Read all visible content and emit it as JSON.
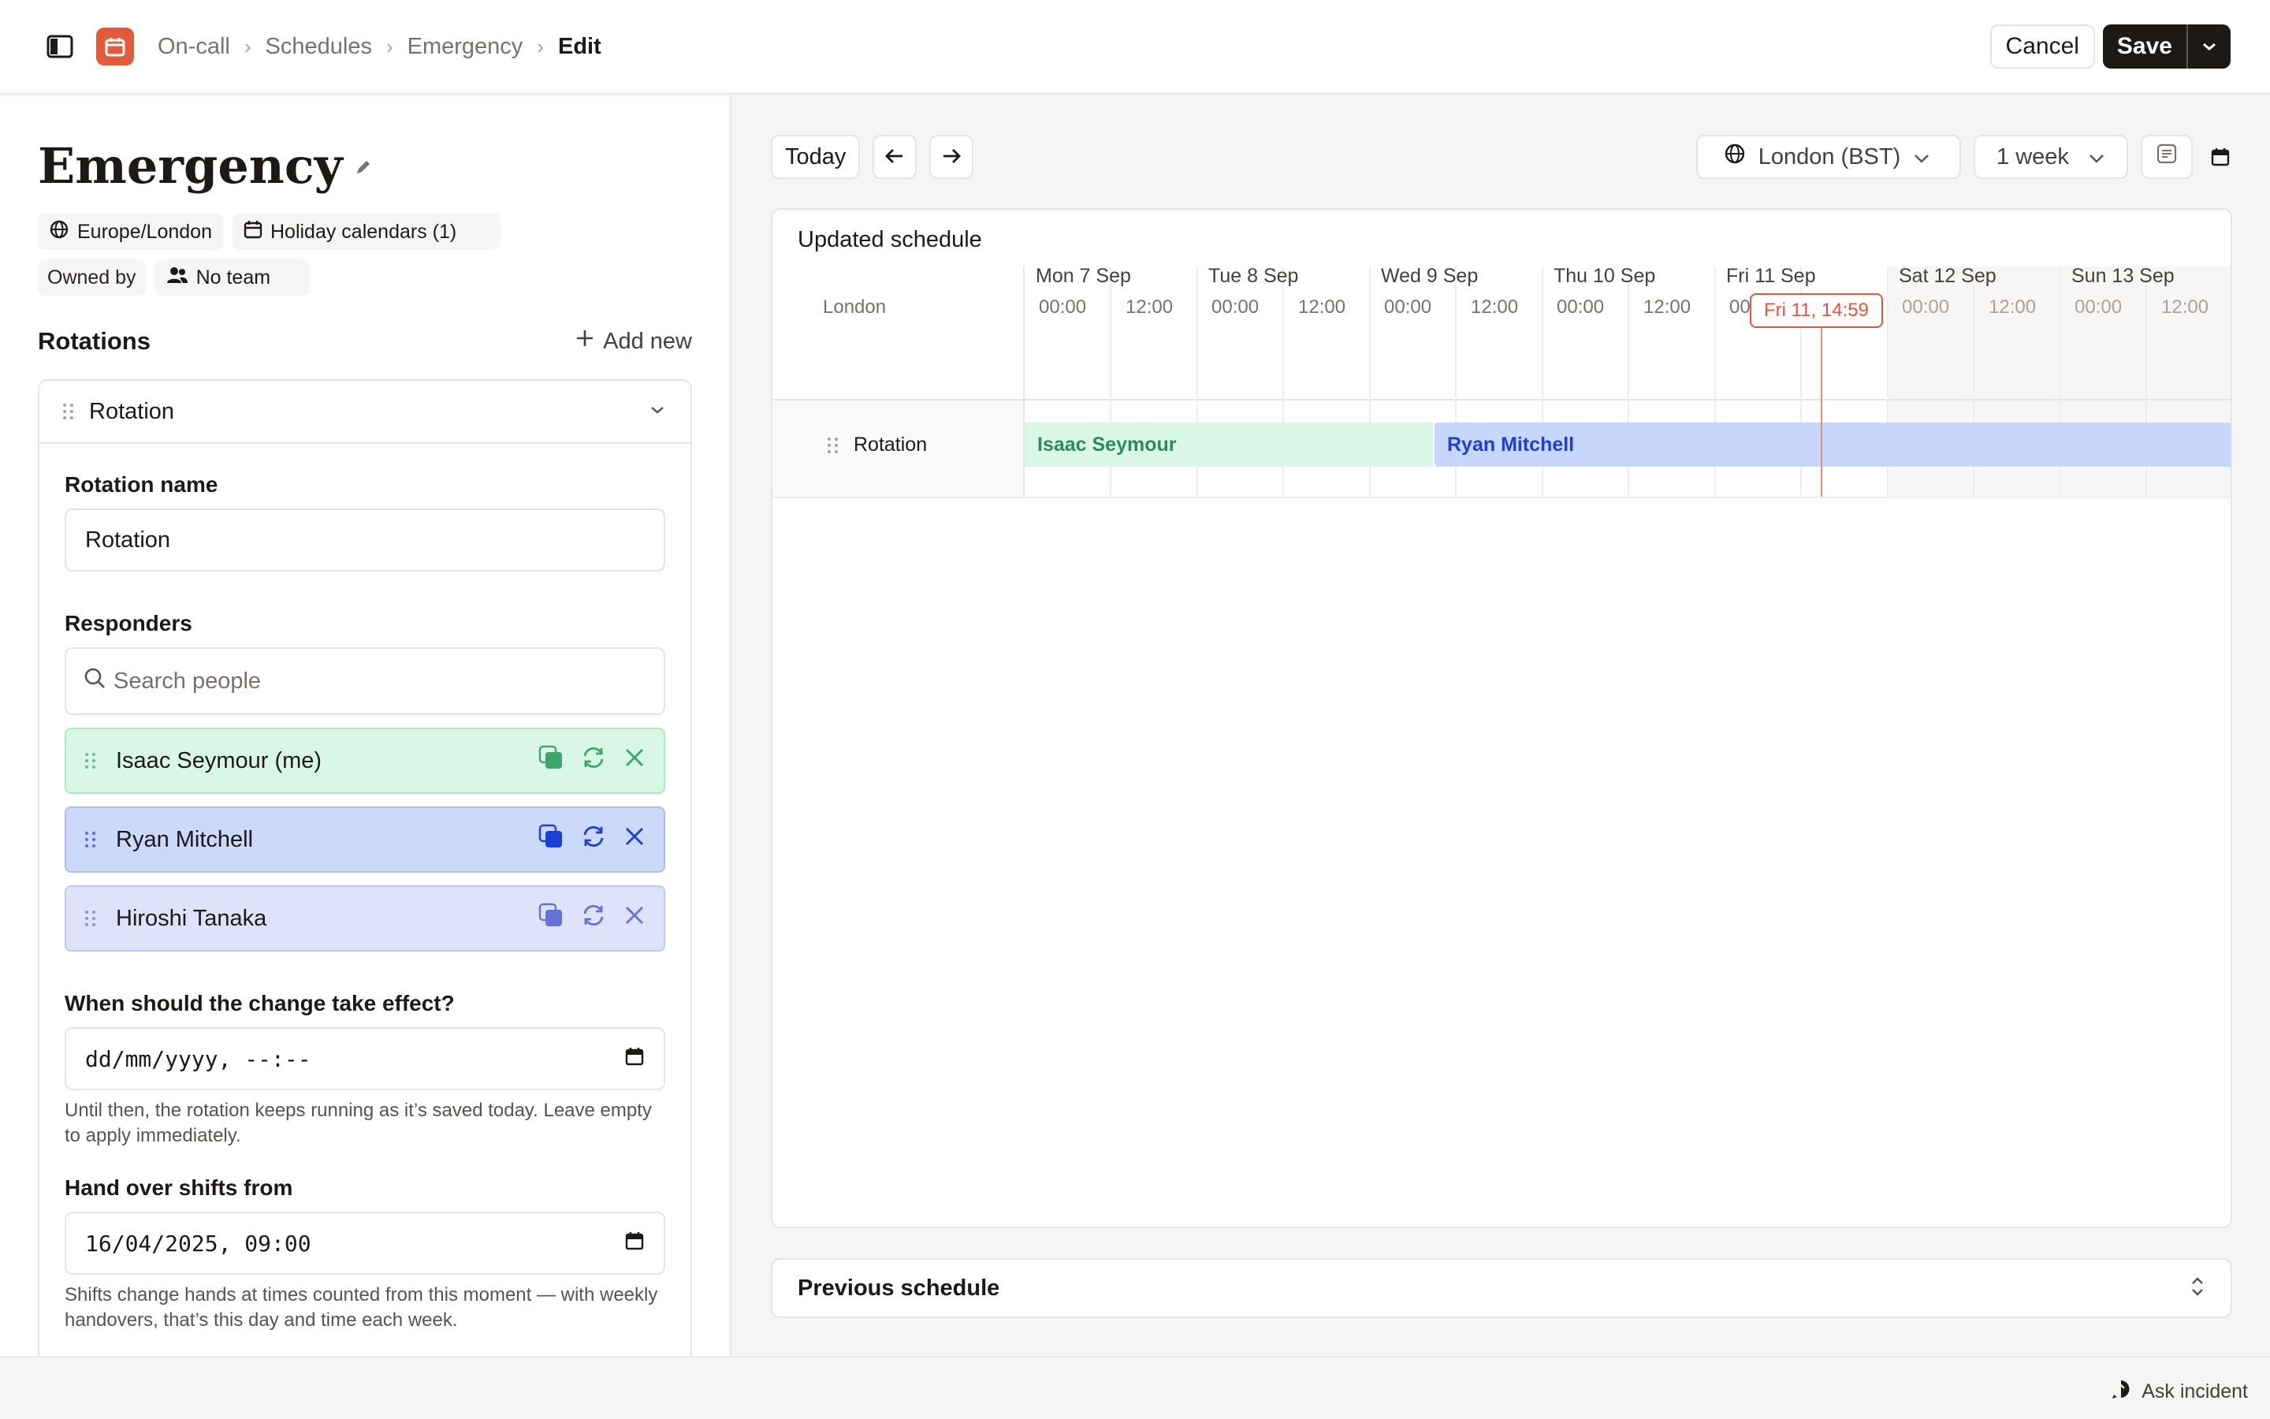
{
  "breadcrumb": [
    "On-call",
    "Schedules",
    "Emergency",
    "Edit"
  ],
  "header": {
    "cancel_label": "Cancel",
    "save_label": "Save"
  },
  "page": {
    "title": "Emergency",
    "timezone_chip": "Europe/London",
    "holiday_chip": "Holiday calendars (1)",
    "owned_by_label": "Owned by",
    "team_chip": "No team"
  },
  "rotations": {
    "title": "Rotations",
    "add_new_label": "Add new",
    "card_title": "Rotation",
    "name_label": "Rotation name",
    "name_value": "Rotation",
    "responders_label": "Responders",
    "search_placeholder": "Search people",
    "responders": [
      {
        "name": "Isaac Seymour (me)",
        "color": "#3aa86b"
      },
      {
        "name": "Ryan Mitchell",
        "color": "#1d3fd8"
      },
      {
        "name": "Hiroshi Tanaka",
        "color": "#6670d9"
      }
    ],
    "effect_label": "When should the change take effect?",
    "effect_value": "dd/mm/yyyy, --:--",
    "effect_help": "Until then, the rotation keeps running as it’s saved today. Leave empty to apply immediately.",
    "handover_label": "Hand over shifts from",
    "handover_value": "16/04/2025, 09:00",
    "handover_help": "Shifts change hands at times counted from this moment — with weekly handovers, that’s this day and time each week."
  },
  "calendar": {
    "today_label": "Today",
    "timezone_label": "London (BST)",
    "range_label": "1 week",
    "schedule_title": "Updated schedule",
    "location_label": "London",
    "days": [
      "Mon 7 Sep",
      "Tue 8 Sep",
      "Wed 9 Sep",
      "Thu 10 Sep",
      "Fri 11 Sep",
      "Sat 12 Sep",
      "Sun 13 Sep"
    ],
    "times": [
      "00:00",
      "12:00"
    ],
    "now_label": "Fri 11, 14:59",
    "row_label": "Rotation",
    "shifts": [
      {
        "name": "Isaac Seymour",
        "color": "#d9f7e6"
      },
      {
        "name": "Ryan Mitchell",
        "color": "#c7d6fb"
      }
    ],
    "previous_title": "Previous schedule"
  },
  "footer": {
    "ask_label": "Ask incident"
  },
  "colors": {
    "accent": "#e25b3a",
    "now_marker": "#e5533c",
    "save_button": "#1c1917"
  }
}
